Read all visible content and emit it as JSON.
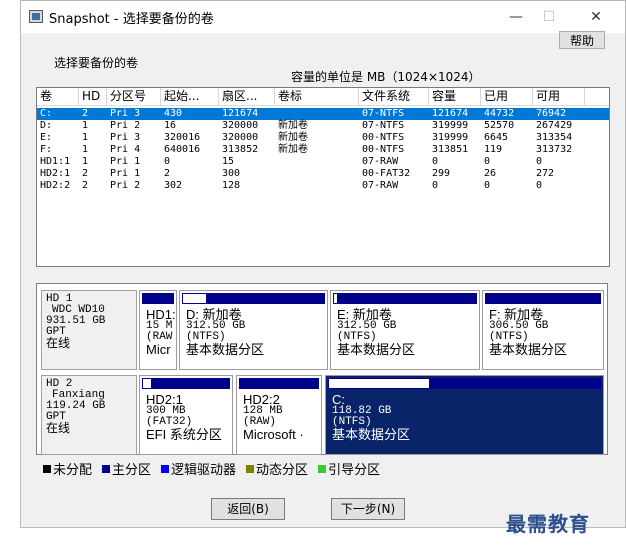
{
  "window": {
    "title": "Snapshot - 选择要备份的卷",
    "minimize": "—",
    "maximize": "☐",
    "close": "✕",
    "help": "帮助"
  },
  "section_label": "选择要备份的卷",
  "unit_label": "容量的单位是 MB（1024×1024）",
  "columns": [
    "卷",
    "HD",
    "分区号",
    "起始...",
    "扇区...",
    "卷标",
    "文件系统",
    "容量",
    "已用",
    "可用"
  ],
  "volumes": [
    {
      "vol": "C:",
      "hd": "2",
      "part": "Pri 3",
      "start": "430",
      "sectors": "121674",
      "label": "",
      "fs": "07-NTFS",
      "cap": "121674",
      "used": "44732",
      "free": "76942",
      "selected": true
    },
    {
      "vol": "D:",
      "hd": "1",
      "part": "Pri 2",
      "start": "16",
      "sectors": "320000",
      "label": "新加卷",
      "fs": "07-NTFS",
      "cap": "319999",
      "used": "52570",
      "free": "267429"
    },
    {
      "vol": "E:",
      "hd": "1",
      "part": "Pri 3",
      "start": "320016",
      "sectors": "320000",
      "label": "新加卷",
      "fs": "00-NTFS",
      "cap": "319999",
      "used": "6645",
      "free": "313354"
    },
    {
      "vol": "F:",
      "hd": "1",
      "part": "Pri 4",
      "start": "640016",
      "sectors": "313852",
      "label": "新加卷",
      "fs": "00-NTFS",
      "cap": "313851",
      "used": "119",
      "free": "313732"
    },
    {
      "vol": "HD1:1",
      "hd": "1",
      "part": "Pri 1",
      "start": "0",
      "sectors": "15",
      "label": "",
      "fs": "07-RAW",
      "cap": "0",
      "used": "0",
      "free": "0"
    },
    {
      "vol": "HD2:1",
      "hd": "2",
      "part": "Pri 1",
      "start": "2",
      "sectors": "300",
      "label": "",
      "fs": "00-FAT32",
      "cap": "299",
      "used": "26",
      "free": "272"
    },
    {
      "vol": "HD2:2",
      "hd": "2",
      "part": "Pri 2",
      "start": "302",
      "sectors": "128",
      "label": "",
      "fs": "07-RAW",
      "cap": "0",
      "used": "0",
      "free": "0"
    }
  ],
  "disk1": {
    "info": [
      "HD 1",
      "WDC WD10",
      "931.51 GB",
      "GPT",
      "在线"
    ],
    "parts": [
      {
        "l1": "HD1:",
        "l2": "15 M",
        "l3": "(RAW",
        "l4": "Micr",
        "usage": 0.0
      },
      {
        "l1": "D: 新加卷",
        "l2": "312.50 GB",
        "l3": "(NTFS)",
        "l4": "基本数据分区",
        "usage": 0.16
      },
      {
        "l1": "E: 新加卷",
        "l2": "312.50 GB",
        "l3": "(NTFS)",
        "l4": "基本数据分区",
        "usage": 0.02
      },
      {
        "l1": "F: 新加卷",
        "l2": "306.50 GB",
        "l3": "(NTFS)",
        "l4": "基本数据分区",
        "usage": 0.0
      }
    ]
  },
  "disk2": {
    "info": [
      "HD 2",
      "Fanxiang",
      "119.24 GB",
      "GPT",
      "在线"
    ],
    "parts": [
      {
        "l1": "HD2:1",
        "l2": "300 MB",
        "l3": "(FAT32)",
        "l4": "EFI 系统分区",
        "usage": 0.09
      },
      {
        "l1": "HD2:2",
        "l2": "128 MB",
        "l3": "(RAW)",
        "l4": "Microsoft ·",
        "usage": 0.0
      },
      {
        "l1": "C:",
        "l2": "118.82 GB",
        "l3": "(NTFS)",
        "l4": "基本数据分区",
        "usage": 0.37
      }
    ]
  },
  "legend": [
    {
      "label": "未分配",
      "color": "#000000"
    },
    {
      "label": "主分区",
      "color": "#00008b"
    },
    {
      "label": "逻辑驱动器",
      "color": "#0000ff"
    },
    {
      "label": "动态分区",
      "color": "#808000"
    },
    {
      "label": "引导分区",
      "color": "#33cc33"
    }
  ],
  "buttons": {
    "back": "返回(B)",
    "next": "下一步(N)"
  },
  "watermark": "最需教育"
}
